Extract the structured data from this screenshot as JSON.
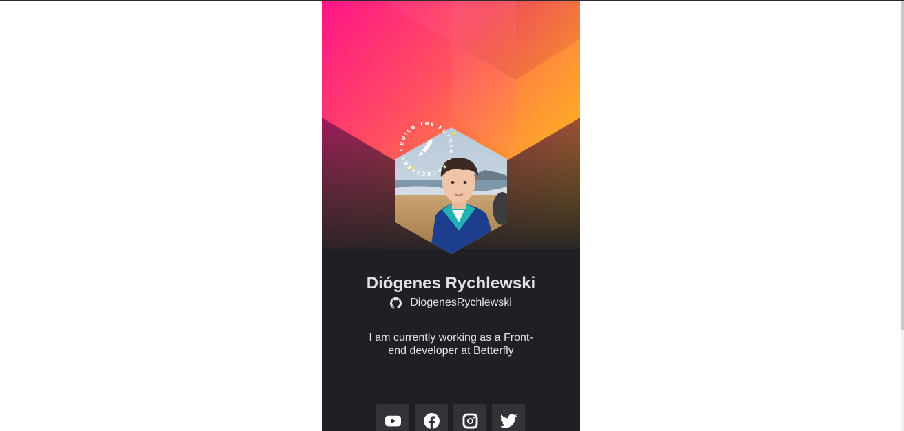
{
  "profile": {
    "name": "Diógenes Rychlewski",
    "github_username": "DiogenesRychlewski",
    "bio": "I am currently working as a Front-end developer at Betterfly",
    "badge_text": "BUILD THE FUTURE • ROCKETSEAT •"
  },
  "socials": [
    {
      "name": "YouTube",
      "icon": "youtube-icon"
    },
    {
      "name": "Facebook",
      "icon": "facebook-icon"
    },
    {
      "name": "Instagram",
      "icon": "instagram-icon"
    },
    {
      "name": "Twitter",
      "icon": "twitter-icon"
    }
  ],
  "colors": {
    "card_background": "#202024",
    "gradient_pink": "#ff1a8c",
    "gradient_orange": "#ffa726",
    "text": "#e1e1e6",
    "button": "#323238"
  }
}
